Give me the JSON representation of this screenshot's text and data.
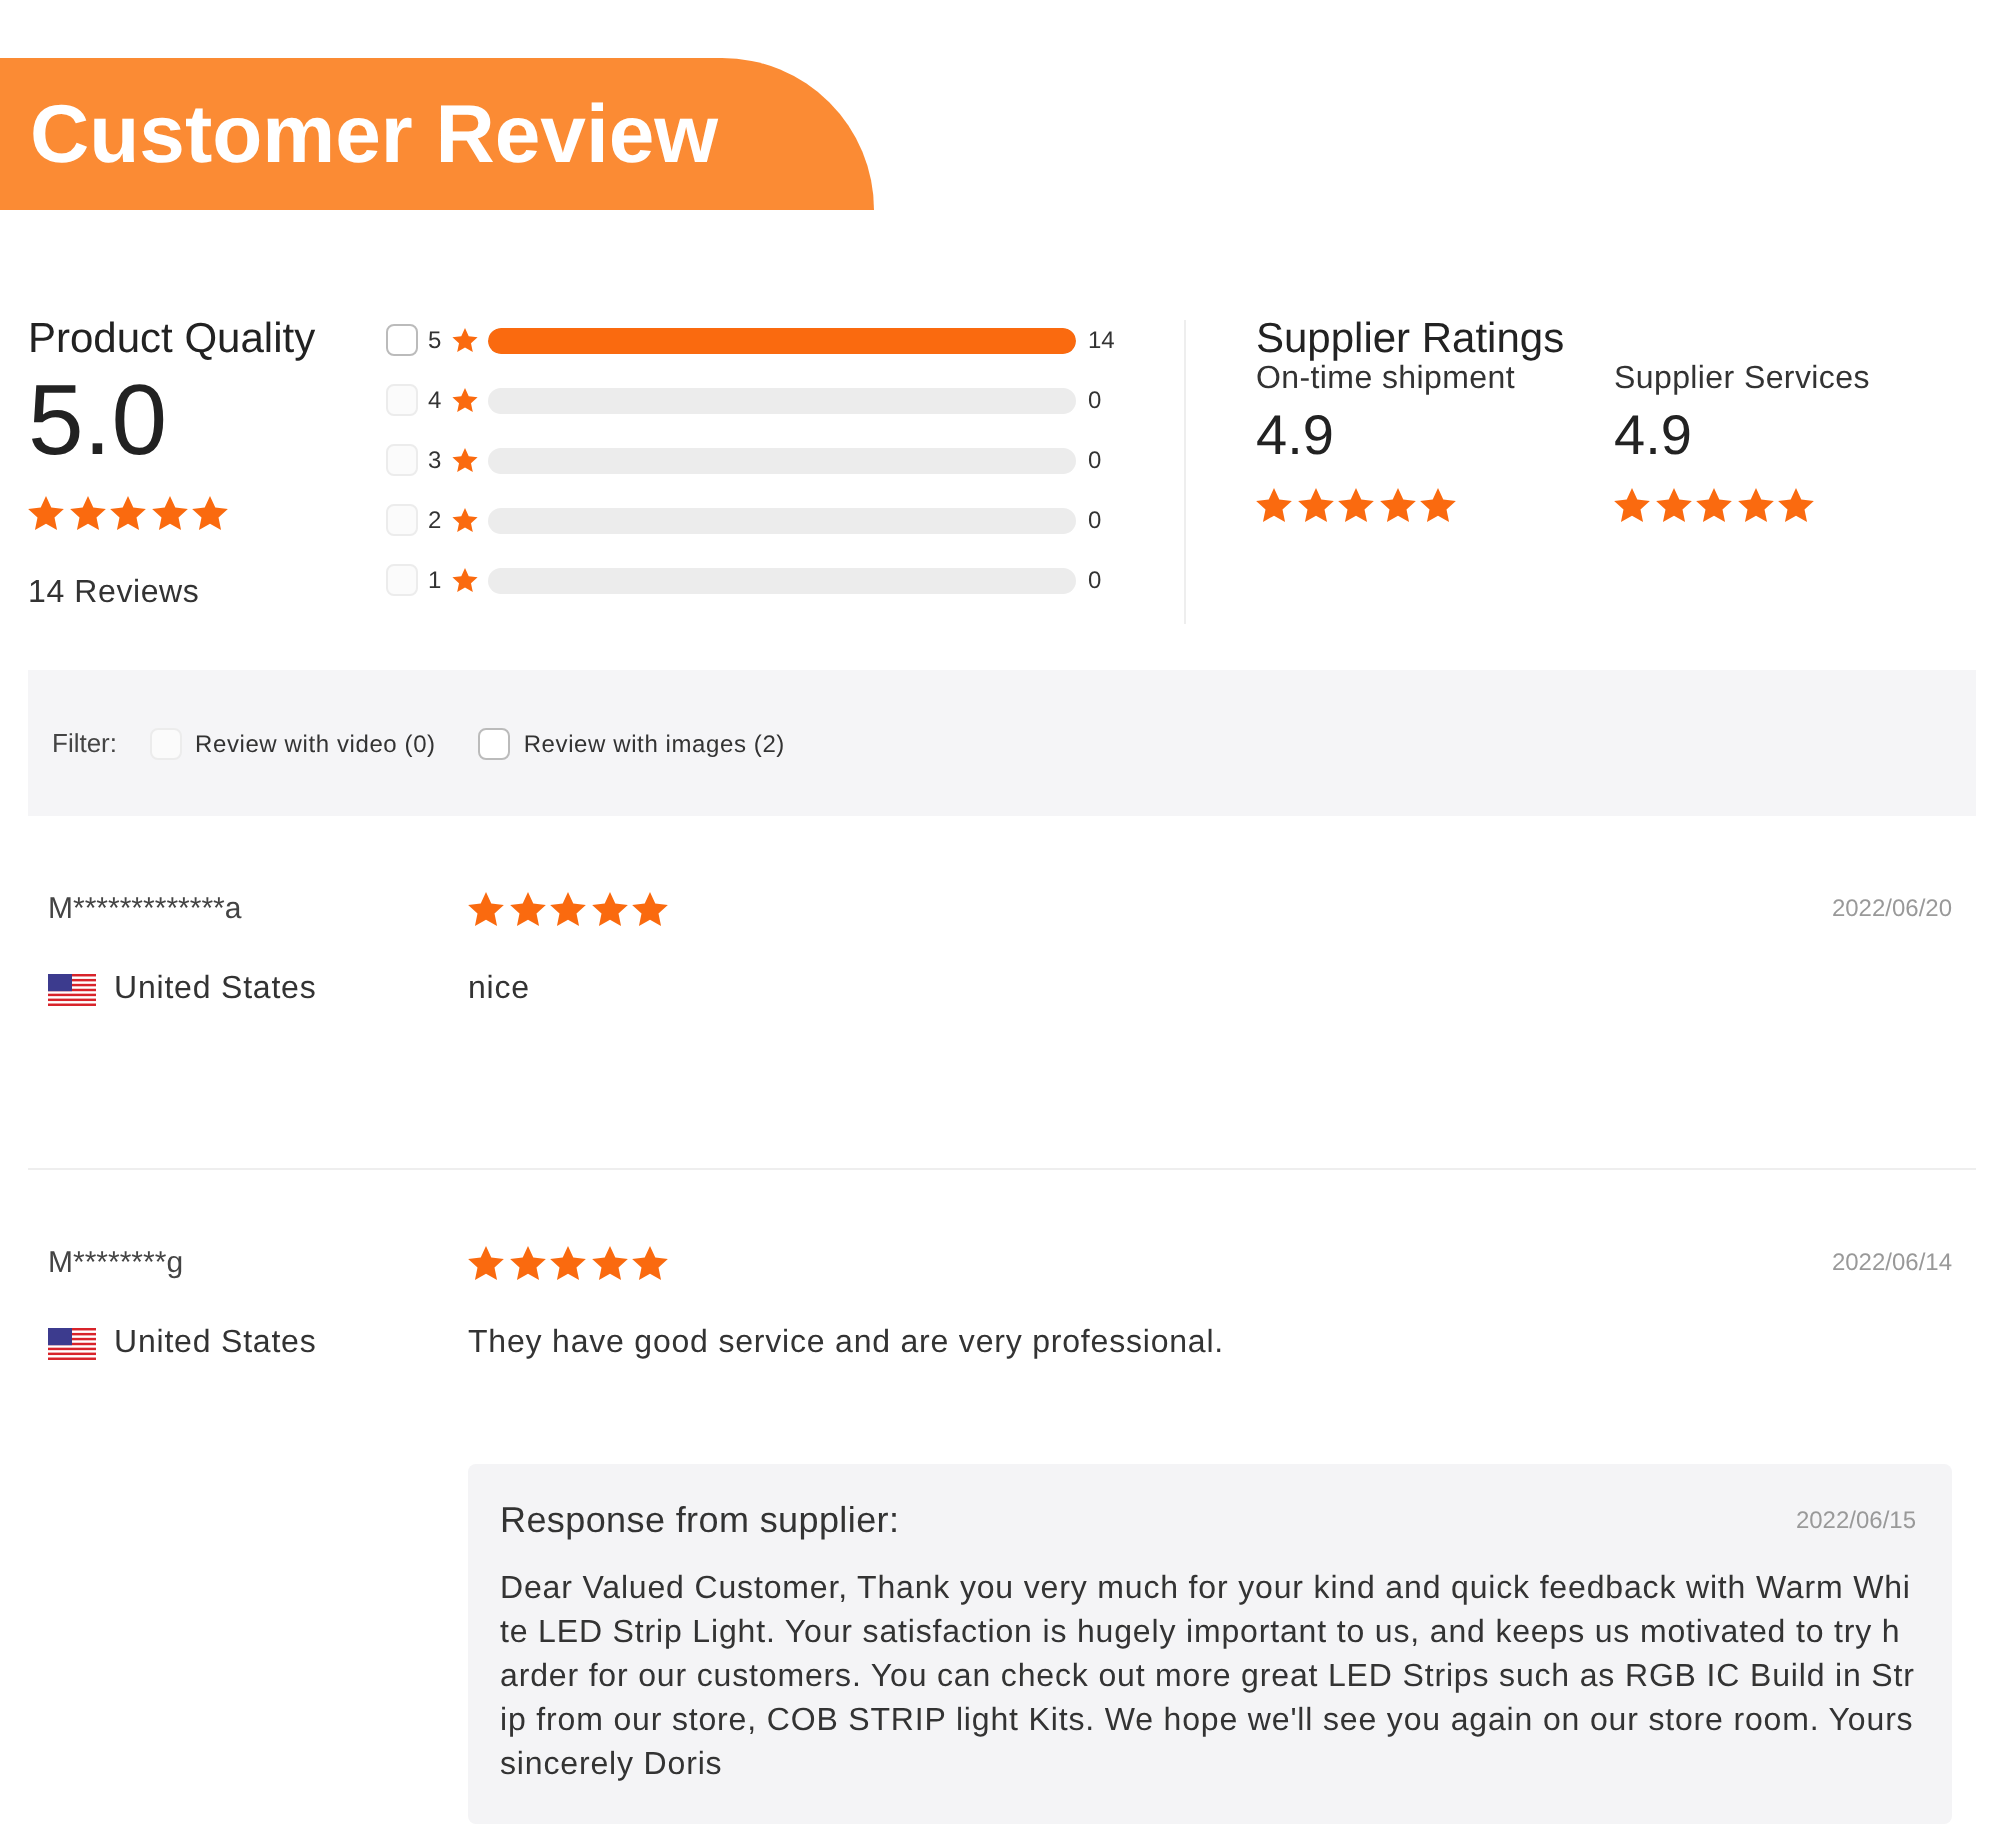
{
  "banner": {
    "title": "Customer Review"
  },
  "product_quality": {
    "title": "Product Quality",
    "score": "5.0",
    "stars": 5,
    "reviews": "14 Reviews"
  },
  "distribution": [
    {
      "label": "5",
      "count": "14",
      "level": 1,
      "checked": false,
      "disabled": false
    },
    {
      "label": "4",
      "count": "0",
      "level": 0,
      "checked": false,
      "disabled": true
    },
    {
      "label": "3",
      "count": "0",
      "level": 0,
      "checked": false,
      "disabled": true
    },
    {
      "label": "2",
      "count": "0",
      "level": 0,
      "checked": false,
      "disabled": true
    },
    {
      "label": "1",
      "count": "0",
      "level": 0,
      "checked": false,
      "disabled": true
    }
  ],
  "supplier_ratings": {
    "title": "Supplier Ratings",
    "items": [
      {
        "label": "On-time shipment",
        "score": "4.9",
        "stars": 5
      },
      {
        "label": "Supplier Services",
        "score": "4.9",
        "stars": 5
      }
    ]
  },
  "filter": {
    "label": "Filter:",
    "options": [
      {
        "label": "Review with video (0)",
        "checked": false,
        "disabled": true
      },
      {
        "label": "Review with images (2)",
        "checked": false,
        "disabled": false
      }
    ]
  },
  "reviews": [
    {
      "name": "M*************a",
      "country": "United States",
      "stars": 5,
      "date": "2022/06/20",
      "text": "nice"
    },
    {
      "name": "M********g",
      "country": "United States",
      "stars": 5,
      "date": "2022/06/14",
      "text": "They have good service and are very professional.",
      "response": {
        "title": "Response from supplier:",
        "date": "2022/06/15",
        "text": "Dear Valued Customer, Thank you very much for your kind and quick feedback with Warm White LED Strip Light. Your satisfaction is hugely important to us, and keeps us motivated to try harder for our customers. You can check out more great LED Strips such as RGB IC Build in Strip from our store, COB STRIP light Kits. We hope we'll see you again on our store room. Yours sincerely Doris"
      }
    }
  ]
}
